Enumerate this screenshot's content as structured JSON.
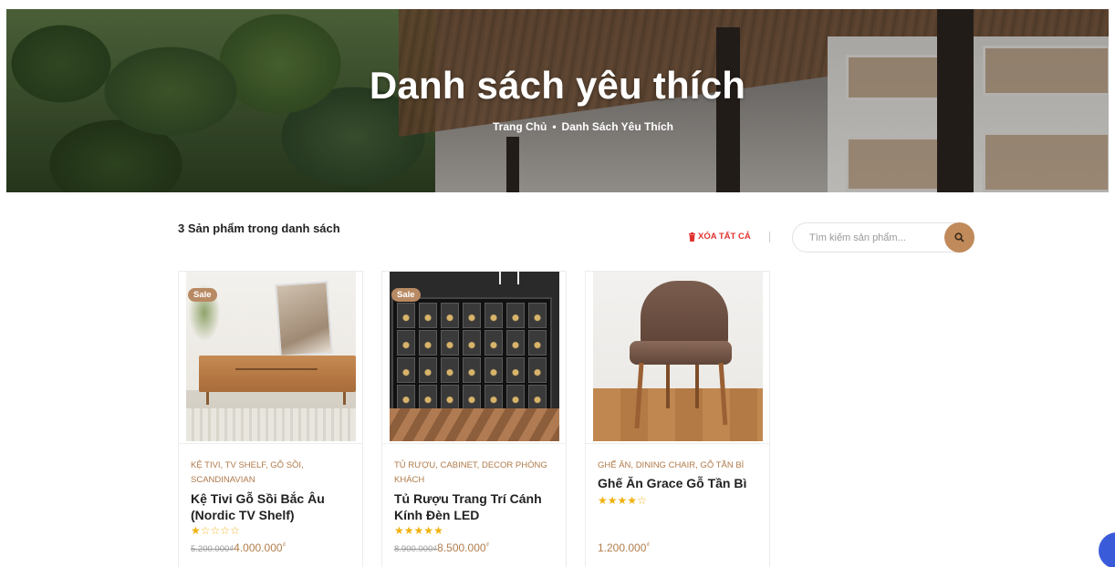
{
  "hero": {
    "title": "Danh sách yêu thích",
    "breadcrumb": {
      "home": "Trang Chủ",
      "separator": "•",
      "current": "Danh Sách Yêu Thích"
    }
  },
  "toolbar": {
    "count_text": "3 Sản phẩm trong danh sách",
    "clear_all": "XÓA TẤT CẢ",
    "search_placeholder": "Tìm kiếm sản phẩm..."
  },
  "products": [
    {
      "sale_badge": "Sale",
      "categories": "KỆ TIVI, TV SHELF, GỖ SỒI, SCANDINAVIAN",
      "name": "Kệ Tivi Gỗ Sồi Bắc Âu (Nordic TV Shelf)",
      "rating": 1,
      "old_price": "5.200.000",
      "currency": "₫",
      "price": "4.000.000"
    },
    {
      "sale_badge": "Sale",
      "categories": "TỦ RƯỢU, CABINET, DECOR PHÒNG KHÁCH",
      "name": "Tủ Rượu Trang Trí Cánh Kính Đèn LED",
      "rating": 5,
      "old_price": "8.900.000",
      "currency": "₫",
      "price": "8.500.000"
    },
    {
      "sale_badge": "",
      "categories": "GHẾ ĂN, DINING CHAIR, GỖ TẦN BÌ",
      "name": "Ghế Ăn Grace Gỗ Tần Bì",
      "rating": 4,
      "old_price": "",
      "currency": "₫",
      "price": "1.200.000"
    }
  ],
  "colors": {
    "accent": "#c08a5a",
    "danger": "#e0322f",
    "star": "#f1b10f",
    "chat": "#3a5bd9"
  },
  "icons": {
    "trash": "trash-icon",
    "search": "search-icon",
    "star_full": "★",
    "star_empty": "☆"
  }
}
